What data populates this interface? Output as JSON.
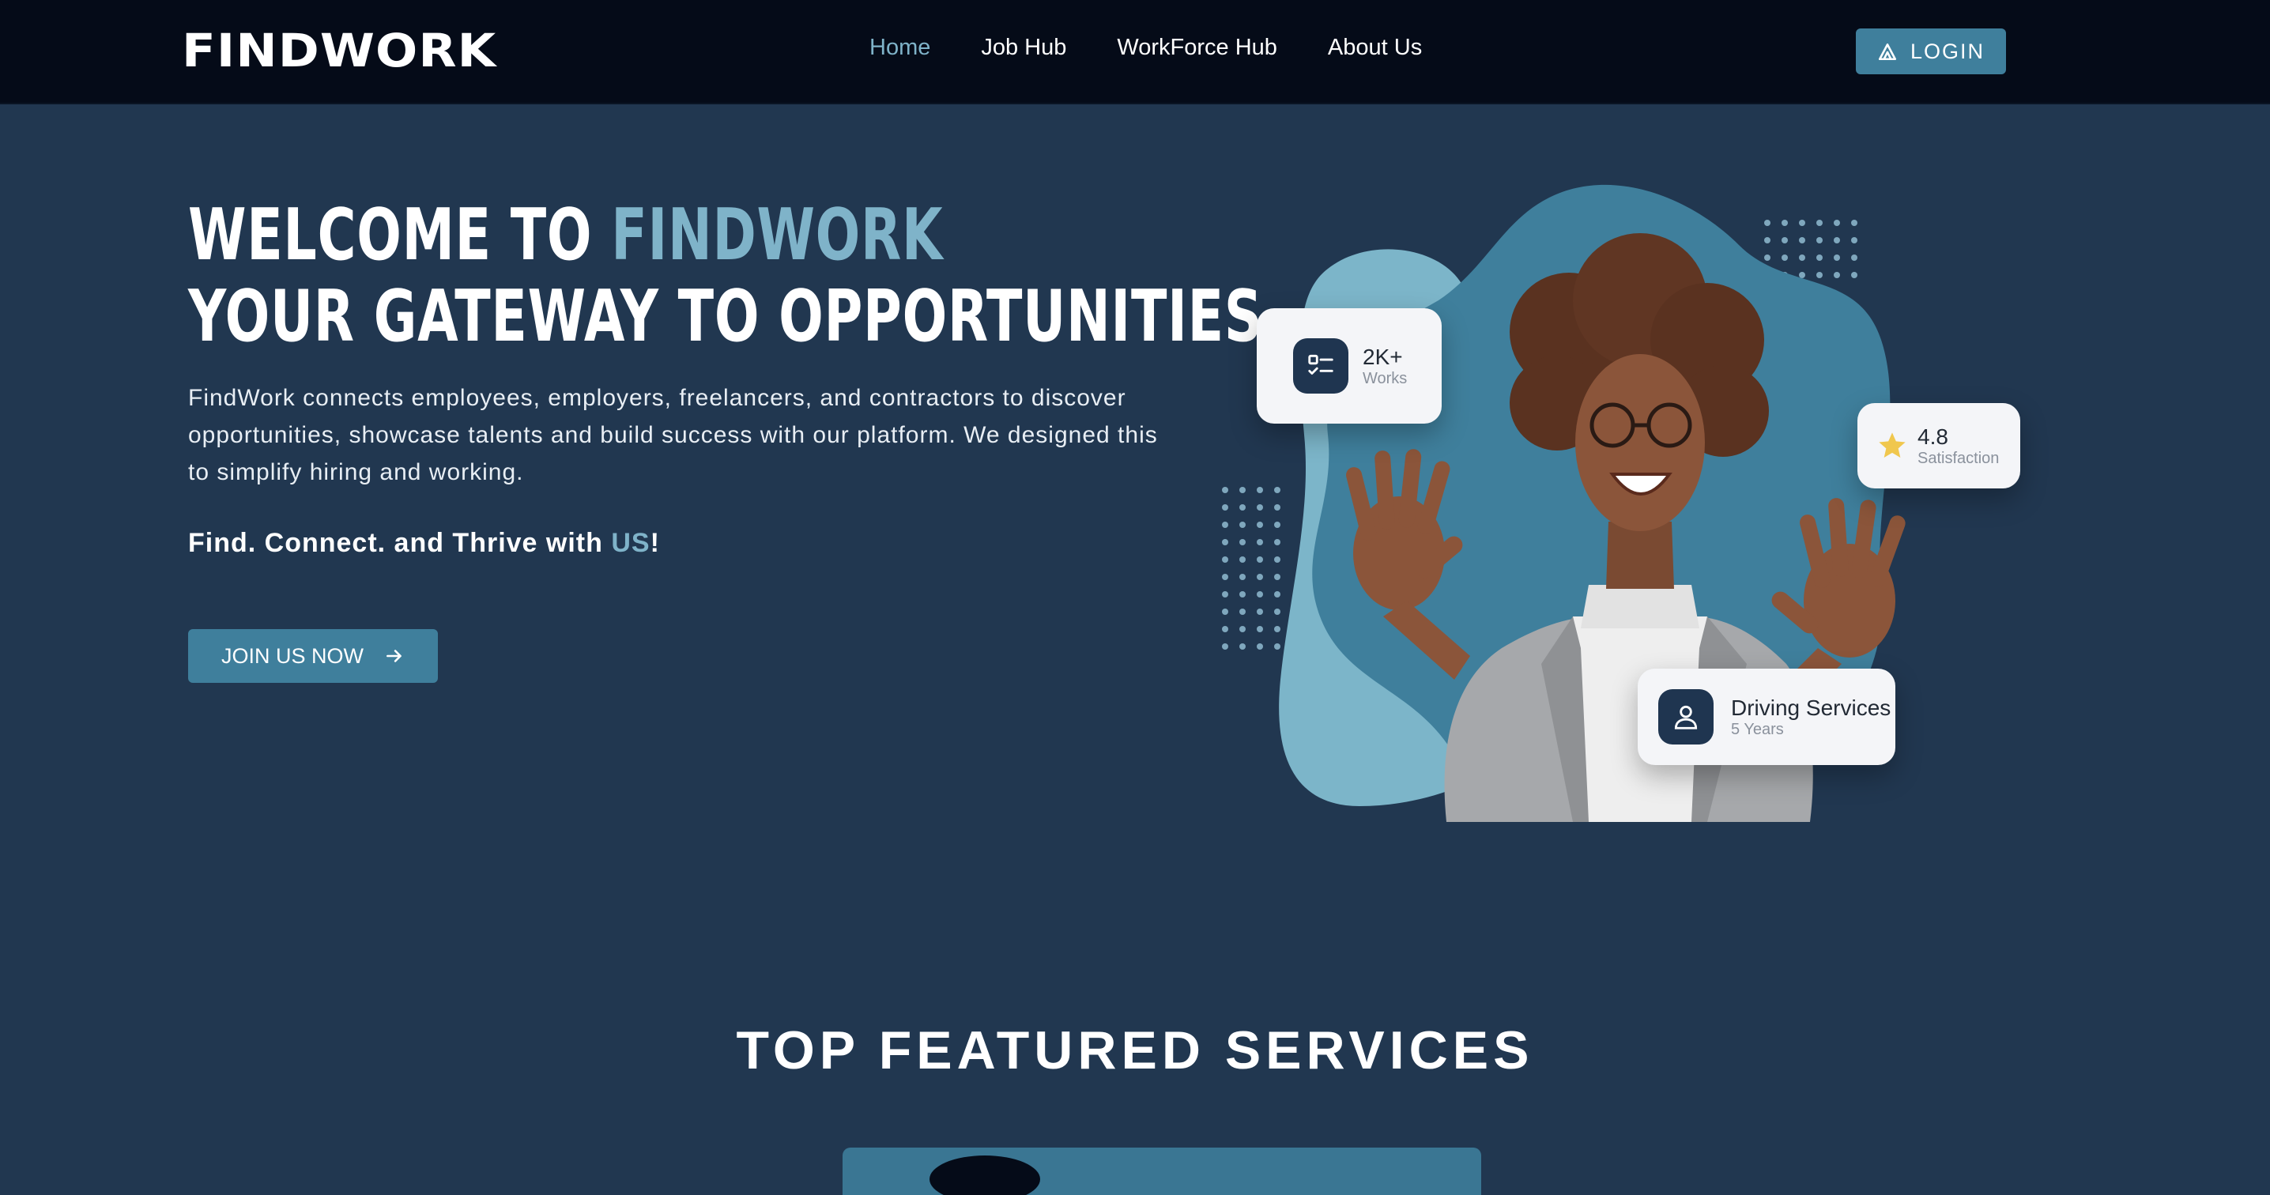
{
  "nav": {
    "logo": "FINDWORK",
    "links": [
      "Home",
      "Job Hub",
      "WorkForce Hub",
      "About Us"
    ],
    "login_label": "LOGIN"
  },
  "hero": {
    "title_line1_prefix": "WELCOME TO ",
    "title_line1_accent": "FINDWORK",
    "title_line2": "YOUR GATEWAY TO OPPORTUNITIES",
    "description": "FindWork connects employees, employers, freelancers, and contractors to discover opportunities, showcase talents and build success with our platform. We designed this to simplify hiring and working.",
    "tagline_prefix": "Find. Connect. and Thrive with ",
    "tagline_accent": "US",
    "tagline_suffix": "!",
    "cta_label": "JOIN US NOW"
  },
  "stats": {
    "works": {
      "value": "2K+",
      "label": "Works"
    },
    "rating": {
      "value": "4.8",
      "label": "Satisfaction"
    },
    "service": {
      "value": "Driving Services",
      "label": "5 Years"
    }
  },
  "section": {
    "title": "TOP FEATURED SERVICES"
  },
  "colors": {
    "background": "#213750",
    "navbar": "#050b18",
    "accent": "#7fb3c9",
    "button": "#3f7f9c",
    "star": "#f0c74e"
  }
}
